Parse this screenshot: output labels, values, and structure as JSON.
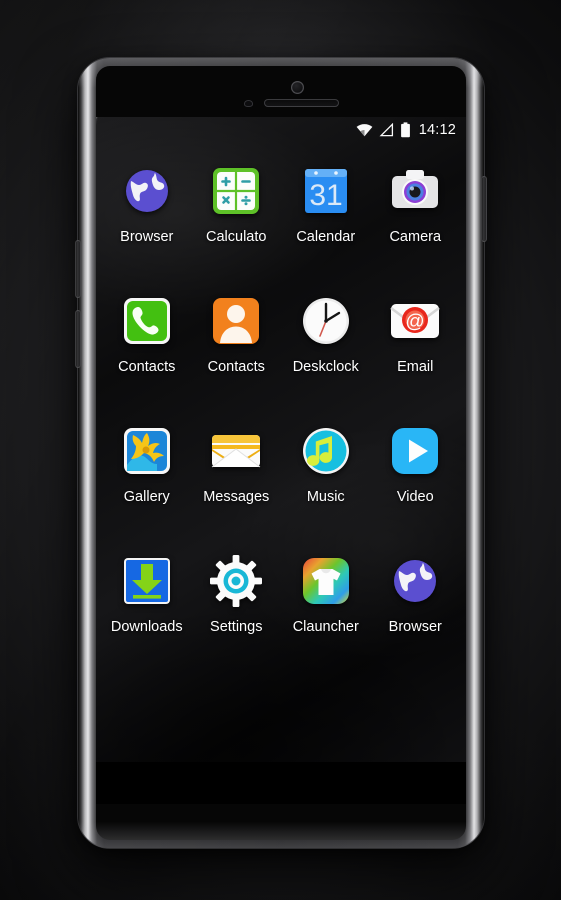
{
  "device": {
    "name": "android-phone-mockup",
    "hardware": {
      "front_camera": "front-camera",
      "earpiece": "earpiece-speaker",
      "proximity_sensor": "proximity-sensor",
      "volume_up": "volume-up-button",
      "volume_down": "volume-down-button",
      "power": "power-button"
    }
  },
  "status_bar": {
    "wifi_icon": "wifi-icon",
    "signal_icon": "cell-signal-icon",
    "battery_icon": "battery-full-icon",
    "time": "14:12"
  },
  "home_screen": {
    "wallpaper": "black-feather-texture",
    "apps": [
      {
        "label": "Browser",
        "icon": "globe-icon",
        "color": "#5b4fd0"
      },
      {
        "label": "Calculato",
        "icon": "calculator-icon",
        "color": "#5ec128"
      },
      {
        "label": "Calendar",
        "icon": "calendar-31-icon",
        "color": "#2a8df2"
      },
      {
        "label": "Camera",
        "icon": "camera-icon",
        "color": "#e3e3e5"
      },
      {
        "label": "Contacts",
        "icon": "phone-icon",
        "color": "#43c011"
      },
      {
        "label": "Contacts",
        "icon": "person-icon",
        "color": "#f2811d"
      },
      {
        "label": "Deskclock",
        "icon": "analog-clock-icon",
        "color": "#f2f2f2"
      },
      {
        "label": "Email",
        "icon": "at-envelope-icon",
        "color": "#e8271c"
      },
      {
        "label": "Gallery",
        "icon": "flower-photo-icon",
        "color": "#f6c518"
      },
      {
        "label": "Messages",
        "icon": "envelope-icon",
        "color": "#f7c53a"
      },
      {
        "label": "Music",
        "icon": "music-note-icon",
        "color": "#17bfe0"
      },
      {
        "label": "Video",
        "icon": "play-icon",
        "color": "#29b6f6"
      },
      {
        "label": "Downloads",
        "icon": "download-icon",
        "color": "#1668e3"
      },
      {
        "label": "Settings",
        "icon": "gear-icon",
        "color": "#18b7d6"
      },
      {
        "label": "Clauncher",
        "icon": "tshirt-icon",
        "color": "#7ad13a"
      },
      {
        "label": "Browser",
        "icon": "globe-icon",
        "color": "#5b4fd0"
      }
    ]
  }
}
